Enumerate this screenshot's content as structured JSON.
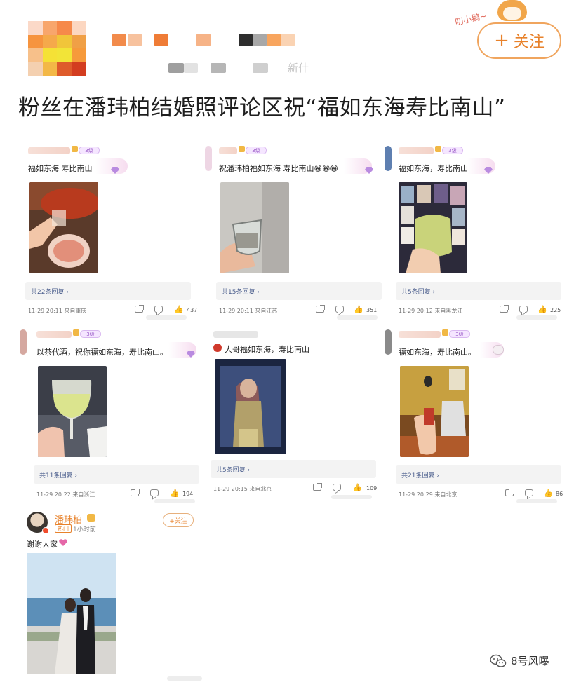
{
  "header": {
    "follow_label": "关注",
    "headline": "粉丝在潘玮柏结婚照评论区祝“福如东海寿比南山”",
    "meta_blur_text": "新什",
    "deco_text": "叨小鹅~"
  },
  "comments": [
    {
      "text": "福如东海 寿比南山",
      "replies": "共22条回复 ›",
      "time": "11-29 20:11 来自重庆",
      "likes": "437",
      "vip": "3级"
    },
    {
      "text": "祝潘玮柏福如东海 寿比南山😁😁😁",
      "replies": "共15条回复 ›",
      "time": "11-29 20:11 来自江苏",
      "likes": "351",
      "vip": "3级"
    },
    {
      "text": "福如东海，寿比南山",
      "replies": "共5条回复 ›",
      "time": "11-29 20:12 来自黑龙江",
      "likes": "225",
      "vip": "3级"
    },
    {
      "text": "以茶代酒，祝你福如东海，寿比南山。",
      "replies": "共11条回复 ›",
      "time": "11-29 20:22 来自浙江",
      "likes": "194",
      "vip": "3级"
    },
    {
      "text": "大哥福如东海，寿比南山",
      "replies": "共5条回复 ›",
      "time": "11-29 20:15 来自北京",
      "likes": "109",
      "vip": ""
    },
    {
      "text": "福如东海，寿比南山。",
      "replies": "共21条回复 ›",
      "time": "11-29 20:29 来自北京",
      "likes": "86",
      "vip": "3级"
    }
  ],
  "post": {
    "author": "潘玮柏",
    "tag": "热门",
    "time": "1小时前",
    "follow_label": "+关注",
    "text": "谢谢大家"
  },
  "brand": {
    "label": "8号风曝"
  },
  "colors": {
    "accent_orange": "#e8822b",
    "follow_border": "#f0a55e",
    "reply_link": "#4a5d8c",
    "vip_purple": "#b98be0"
  }
}
